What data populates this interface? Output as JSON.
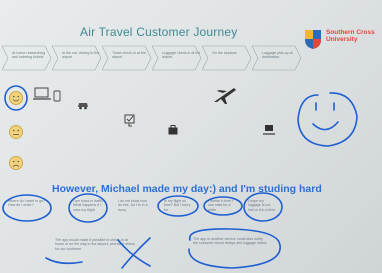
{
  "slide": {
    "title": "Air Travel Customer Journey",
    "university": {
      "line1": "Southern Cross",
      "line2": "University"
    }
  },
  "stages": [
    "At home researching and ordering tickets",
    "In the car, driving to the airport",
    "Ticket check-in at the airport",
    "Luggage check-in at the airport",
    "On the airplane",
    "Luggage pick-up at destination"
  ],
  "caption": "However, Michael made my day:) and I'm studing hard",
  "notes": {
    "n1": "Where do I want to go? How do I order?",
    "n2": "I am stuck in traffic. What happens if I miss my flight",
    "n3": "I do not know how do this. Do I'm in a hurry",
    "n4": "Is my flight on time? But I hurry for",
    "n5": "I needs it from I can miss for a while",
    "n6": "I hope my luggage is not lost or it in a time",
    "n7": "The app would make it possible to check-in at home or on the way to the airport, and save stress for our customer",
    "n8": "The app or another service could also notify the customer about delays and luggage status"
  },
  "colors": {
    "accent": "#3e8a93",
    "ink": "#1f5fd0",
    "brand": "#e8463c"
  },
  "icons": [
    "laptop-icon",
    "phone-icon",
    "car-icon",
    "check-in-kiosk-icon",
    "luggage-icon",
    "airplane-icon",
    "luggage-carousel-icon",
    "happy-face-icon",
    "neutral-face-icon",
    "sad-face-icon",
    "smiley-drawing-icon"
  ]
}
